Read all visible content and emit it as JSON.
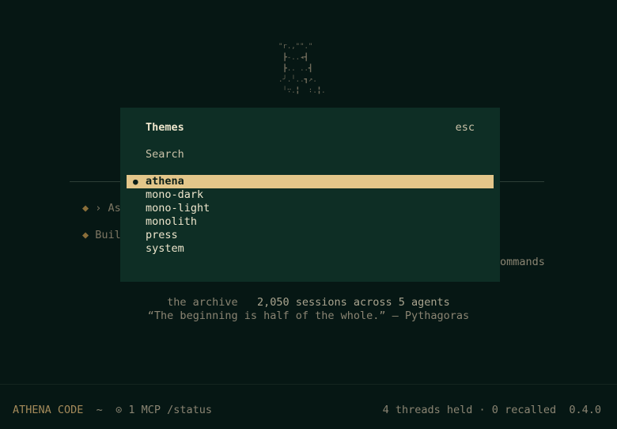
{
  "background": {
    "logo_art": "\"r.,\"\".\"\n ┣-..◂┫\n ┣.. ..┫\n.╯.╵..┓↗.\n ╵∵.╏  ∶.╏.",
    "items": [
      {
        "diamond": "◆",
        "text": "› As"
      },
      {
        "diamond": "◆",
        "text": "Buil"
      }
    ],
    "commands_fragment": "ommands",
    "archive": {
      "label": "the archive",
      "stats": "2,050 sessions across 5 agents"
    },
    "quote": "“The beginning is half of the whole.” — Pythagoras"
  },
  "modal": {
    "title": "Themes",
    "esc_label": "esc",
    "search_placeholder": "Search",
    "selected_marker": "●",
    "themes": [
      "athena",
      "mono-dark",
      "mono-light",
      "monolith",
      "press",
      "system"
    ],
    "selected_index": 0
  },
  "statusbar": {
    "brand": "ATHENA CODE",
    "separator": "~",
    "mcp_icon": "⊙",
    "mcp_status": "1 MCP /status",
    "threads": "4 threads held · 0 recalled",
    "version": "0.4.0"
  },
  "colors": {
    "background": "#061714",
    "modal_background": "#0e2e25",
    "selection": "#e3c68a",
    "accent": "#a48a5a"
  }
}
